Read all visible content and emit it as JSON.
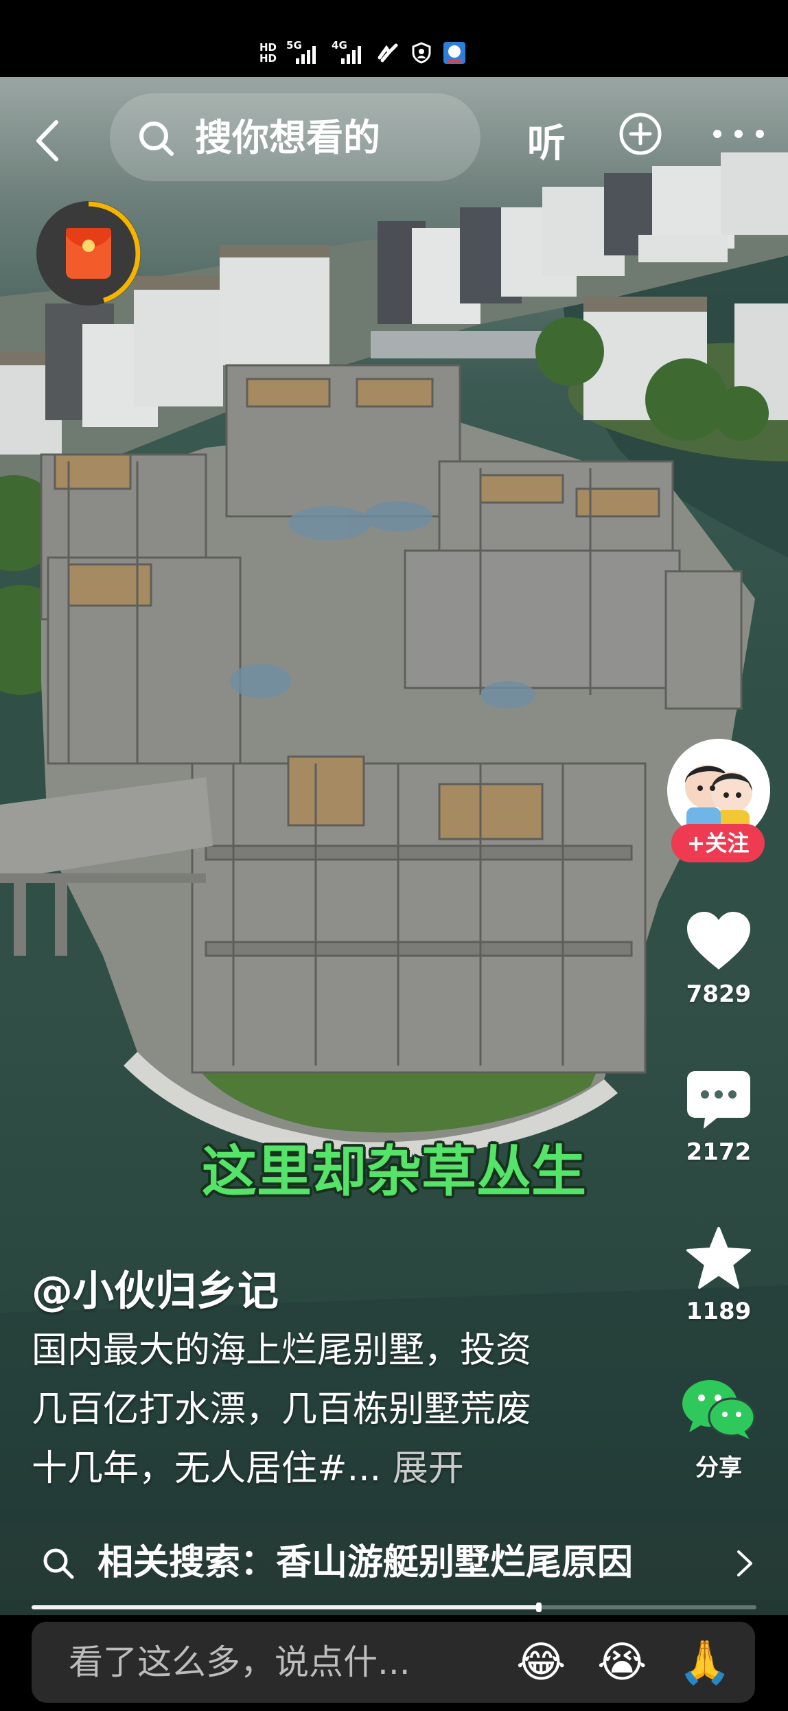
{
  "status_bar": {
    "hd_top": "HD",
    "hd_bottom": "HD",
    "signal1_label": "5G",
    "signal2_label": "4G",
    "icons": [
      "nfc-icon",
      "shield-icon",
      "app-badge-icon"
    ]
  },
  "top_nav": {
    "back_icon": "back-chevron-icon",
    "search_placeholder": "搜你想看的",
    "listen_label": "听",
    "plus_icon": "plus-circle-icon",
    "more_icon": "more-dots-icon"
  },
  "red_packet": {
    "icon": "red-envelope-icon",
    "progress": 0.45,
    "accent": "#f5b400"
  },
  "right_rail": {
    "follow_label": "+关注",
    "like_count": "7829",
    "comment_count": "2172",
    "favorite_count": "1189",
    "share_label": "分享"
  },
  "video": {
    "subtitle": "这里却杂草丛生"
  },
  "post": {
    "author": "@小伙归乡记",
    "description_lines": [
      "国内最大的海上烂尾别墅，投资",
      "几百亿打水漂，几百栋别墅荒废",
      "十几年，无人居住#..."
    ],
    "expand_label": "展开"
  },
  "related_search": {
    "label": "相关搜索：香山游艇别墅烂尾原因",
    "progress": 0.7
  },
  "comment_bar": {
    "placeholder": "看了这么多，说点什...",
    "emojis": [
      "😂",
      "😭",
      "🙏"
    ]
  },
  "colors": {
    "follow_red": "#ee3b52",
    "subtitle_green": "#55e36a",
    "wechat_green": "#2fc85a"
  }
}
